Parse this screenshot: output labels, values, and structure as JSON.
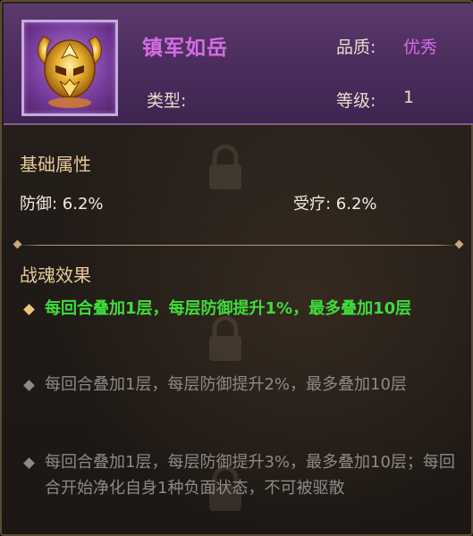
{
  "item": {
    "name": "镇军如岳",
    "quality_label": "品质:",
    "quality_value": "优秀",
    "type_label": "类型:",
    "type_value": "",
    "level_label": "等级:",
    "level_value": "1",
    "icon": "golden-horned-helmet-icon"
  },
  "base_attributes": {
    "title": "基础属性",
    "items": [
      {
        "label": "防御: 6.2%"
      },
      {
        "label": "受疗: 6.2%"
      }
    ]
  },
  "effects": {
    "title": "战魂效果",
    "items": [
      {
        "text": "每回合叠加1层，每层防御提升1%，最多叠加10层",
        "active": true
      },
      {
        "text": "每回合叠加1层，每层防御提升2%，最多叠加10层",
        "active": false
      },
      {
        "text": "每回合叠加1层，每层防御提升3%，最多叠加10层；每回合开始净化自身1种负面状态，不可被驱散",
        "active": false
      }
    ]
  },
  "colors": {
    "name": "#d66be6",
    "quality": "#d66be6",
    "active_effect": "#3fdc3a",
    "inactive_effect": "#8d8a88",
    "section_title": "#e6c89a"
  }
}
